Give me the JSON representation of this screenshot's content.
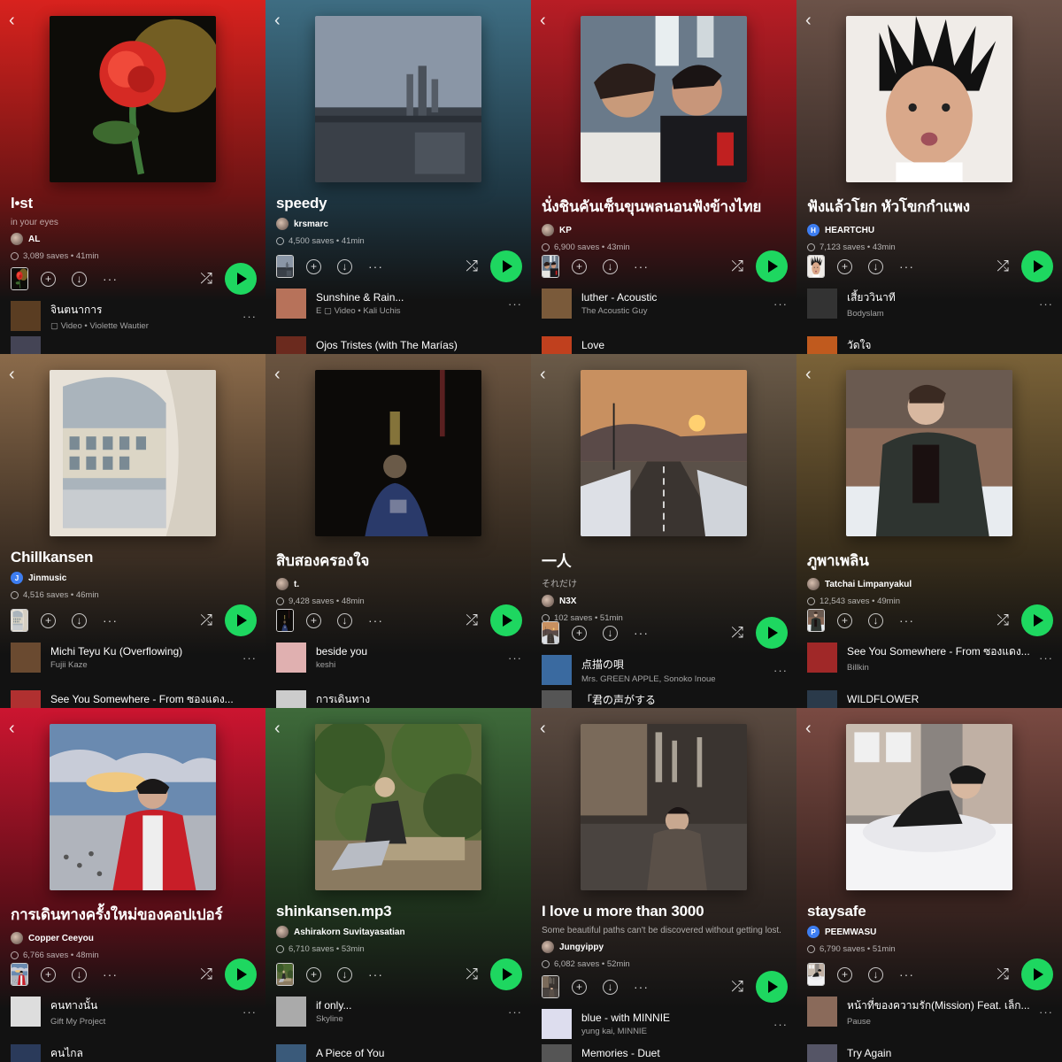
{
  "back_glyph": "‹",
  "panels": [
    {
      "title": "l•st",
      "description": "in your eyes",
      "owner": "AL",
      "owner_badge": "",
      "saves": "3,089 saves • 41min",
      "bg_top": "#d8221e",
      "bg_mid": "#6d1414",
      "track1": {
        "name": "จินตนาการ",
        "sub": "▢ Video • Violette Wautier"
      },
      "track2": {
        "name": ""
      },
      "cover": "rose",
      "thumb1": "#5a3d22",
      "thumb2": "#445"
    },
    {
      "title": "speedy",
      "description": "",
      "owner": "krsmarc",
      "owner_badge": "",
      "saves": "4,500 saves • 41min",
      "bg_top": "#3e6d82",
      "bg_mid": "#1e3642",
      "track1": {
        "name": "Sunshine & Rain...",
        "sub": "E ▢ Video • Kali Uchis"
      },
      "track2": {
        "name": "Ojos Tristes (with The Marías)"
      },
      "cover": "city",
      "thumb1": "#b7725a",
      "thumb2": "#6b2a1e"
    },
    {
      "title": "นั่งชินคันเซ็นขุนพลนอนฟังข้างไทย",
      "description": "",
      "owner": "KP",
      "owner_badge": "",
      "saves": "6,900 saves • 43min",
      "bg_top": "#b81d25",
      "bg_mid": "#5a1216",
      "track1": {
        "name": "luther - Acoustic",
        "sub": "The Acoustic Guy"
      },
      "track2": {
        "name": "Love"
      },
      "cover": "train",
      "thumb1": "#7a5a3a",
      "thumb2": "#c0401e"
    },
    {
      "title": "ฟังแล้วโยก หัวโขกกำแพง",
      "description": "",
      "owner": "HEARTCHU",
      "owner_badge": "H",
      "saves": "7,123 saves • 43min",
      "bg_top": "#6b5248",
      "bg_mid": "#3a2c27",
      "track1": {
        "name": "เสี้ยววินาที",
        "sub": "Bodyslam"
      },
      "track2": {
        "name": "วัดใจ"
      },
      "cover": "face",
      "thumb1": "#333",
      "thumb2": "#c05a1e"
    },
    {
      "title": "Chillkansen",
      "description": "",
      "owner": "Jinmusic",
      "owner_badge": "J",
      "saves": "4,516 saves • 46min",
      "bg_top": "#8a6a4a",
      "bg_mid": "#3e3024",
      "track1": {
        "name": "Michi Teyu Ku (Overflowing)",
        "sub": "Fujii Kaze"
      },
      "track2": {
        "name": "See You Somewhere - From ซองแดง..."
      },
      "cover": "window",
      "thumb1": "#6a4a30",
      "thumb2": "#b03030"
    },
    {
      "title": "สิบสองครองใจ",
      "description": "",
      "owner": "t.",
      "owner_badge": "",
      "saves": "9,428 saves • 48min",
      "bg_top": "#6a5440",
      "bg_mid": "#33291f",
      "track1": {
        "name": "beside you",
        "sub": "keshi"
      },
      "track2": {
        "name": "การเดินทาง"
      },
      "cover": "dark",
      "thumb1": "#e0b0b0",
      "thumb2": "#cccccc"
    },
    {
      "title": "一人",
      "description": "それだけ",
      "owner": "N3X",
      "owner_badge": "",
      "saves": "102 saves • 51min",
      "bg_top": "#6a5a48",
      "bg_mid": "#332b22",
      "track1": {
        "name": "点描の唄",
        "sub": "Mrs. GREEN APPLE, Sonoko Inoue"
      },
      "track2": {
        "name": "「君の声がする"
      },
      "cover": "road",
      "thumb1": "#3a6aa0",
      "thumb2": "#555"
    },
    {
      "title": "ภูพาเพลิน",
      "description": "",
      "owner": "Tatchai Limpanyakul",
      "owner_badge": "",
      "saves": "12,543 saves • 49min",
      "bg_top": "#7a6238",
      "bg_mid": "#3a2f1c",
      "track1": {
        "name": "See You Somewhere - From ซองแดง...",
        "sub": "Billkin"
      },
      "track2": {
        "name": "WILDFLOWER"
      },
      "cover": "snow",
      "thumb1": "#a02828",
      "thumb2": "#2a3a4a"
    },
    {
      "title": "การเดินทางครั้งใหม่ของคอปเปอร์",
      "description": "",
      "owner": "Copper Ceeyou",
      "owner_badge": "",
      "saves": "6,766 saves • 48min",
      "bg_top": "#cc1530",
      "bg_mid": "#5e0e18",
      "track1": {
        "name": "คนทางนั้น",
        "sub": "Gift My Project"
      },
      "track2": {
        "name": "คนไกล"
      },
      "cover": "sky",
      "thumb1": "#ddd",
      "thumb2": "#2a3a5a"
    },
    {
      "title": "shinkansen.mp3",
      "description": "",
      "owner": "Ashirakorn Suvitayasatian",
      "owner_badge": "",
      "saves": "6,710 saves • 53min",
      "bg_top": "#3e6a3a",
      "bg_mid": "#1f331d",
      "track1": {
        "name": "if only...",
        "sub": "Skyline"
      },
      "track2": {
        "name": "A Piece of You"
      },
      "cover": "bush",
      "thumb1": "#aaa",
      "thumb2": "#3a5a7a"
    },
    {
      "title": "I love u more than 3000",
      "description": "Some beautiful paths can't be discovered without getting lost.",
      "owner": "Jungyippy",
      "owner_badge": "",
      "saves": "6,082 saves • 52min",
      "bg_top": "#5a4a40",
      "bg_mid": "#2c2420",
      "track1": {
        "name": "blue - with MINNIE",
        "sub": "yung kai, MINNIE"
      },
      "track2": {
        "name": "Memories - Duet"
      },
      "cover": "street",
      "thumb1": "#dde",
      "thumb2": "#555"
    },
    {
      "title": "staysafe",
      "description": "",
      "owner": "PEEMWASU",
      "owner_badge": "P",
      "saves": "6,790 saves • 51min",
      "bg_top": "#7a4a42",
      "bg_mid": "#3a2420",
      "track1": {
        "name": "หน้าที่ของความรัก(Mission) Feat. เล็ก...",
        "sub": "Pause"
      },
      "track2": {
        "name": "Try Again"
      },
      "cover": "bed",
      "thumb1": "#8a6a5a",
      "thumb2": "#556"
    }
  ],
  "icons": {
    "back": "chevron-left-icon",
    "add": "add-circle-icon",
    "download": "download-icon",
    "more": "more-icon",
    "shuffle": "shuffle-icon",
    "play": "play-icon",
    "globe": "globe-icon"
  }
}
